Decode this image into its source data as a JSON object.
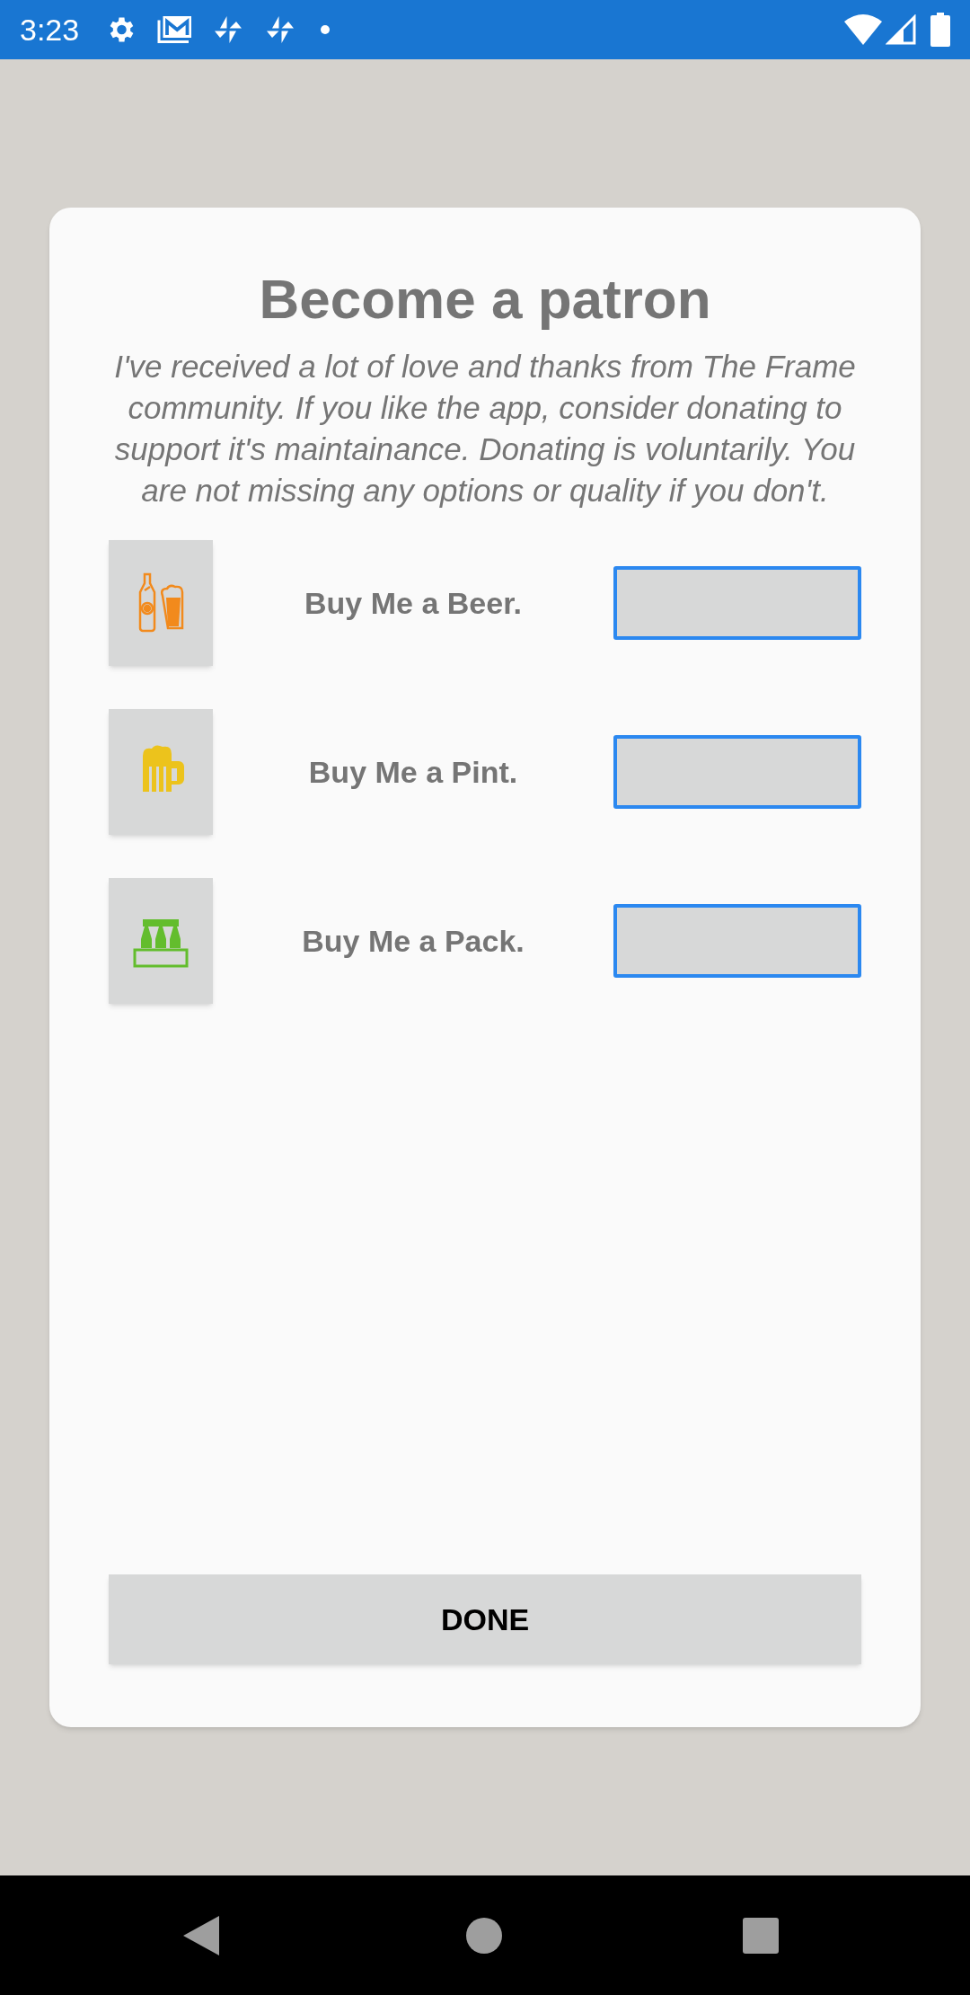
{
  "status_bar": {
    "time": "3:23"
  },
  "dialog": {
    "title": "Become a patron",
    "message": "I've received a lot of love and thanks from The Frame community. If you like the app, consider donating to support it's maintainance. Donating is voluntarily. You are not missing any options or quality if you don't.",
    "options": [
      {
        "kind": "bottle-and-glass",
        "label": "Buy Me a Beer."
      },
      {
        "kind": "mug",
        "label": "Buy Me a Pint."
      },
      {
        "kind": "six-pack",
        "label": "Buy Me a Pack."
      }
    ],
    "button": "DONE"
  }
}
